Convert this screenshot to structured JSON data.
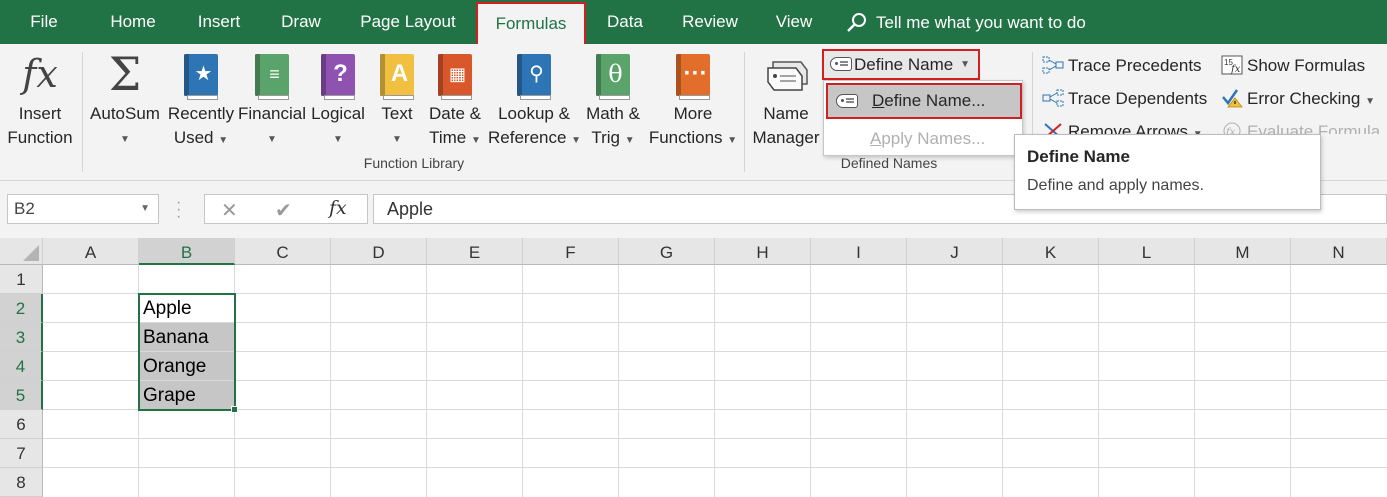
{
  "tabs": [
    "File",
    "Home",
    "Insert",
    "Draw",
    "Page Layout",
    "Formulas",
    "Data",
    "Review",
    "View"
  ],
  "active_tab": "Formulas",
  "tell_me": "Tell me what you want to do",
  "ribbon": {
    "insert_function": {
      "line1": "Insert",
      "line2": "Function"
    },
    "function_library": {
      "autosum": {
        "line1": "AutoSum"
      },
      "recently_used": {
        "line1": "Recently",
        "line2": "Used"
      },
      "financial": {
        "line1": "Financial"
      },
      "logical": {
        "line1": "Logical"
      },
      "text": {
        "line1": "Text"
      },
      "date_time": {
        "line1": "Date &",
        "line2": "Time"
      },
      "lookup_reference": {
        "line1": "Lookup &",
        "line2": "Reference"
      },
      "math_trig": {
        "line1": "Math &",
        "line2": "Trig"
      },
      "more_functions": {
        "line1": "More",
        "line2": "Functions"
      },
      "group_label": "Function Library"
    },
    "defined_names": {
      "name_manager": {
        "line1": "Name",
        "line2": "Manager"
      },
      "define_name": "Define Name",
      "group_label": "Defined Names"
    },
    "formula_auditing": {
      "trace_precedents": "Trace Precedents",
      "trace_dependents": "Trace Dependents",
      "remove_arrows": "Remove Arrows",
      "show_formulas": "Show Formulas",
      "error_checking": "Error Checking",
      "evaluate_formula": "Evaluate Formula"
    }
  },
  "dropdown": {
    "define_name_item": {
      "first_letter": "D",
      "rest": "efine Name..."
    },
    "apply_names_item": {
      "first_letter": "A",
      "rest": "pply Names..."
    }
  },
  "tooltip": {
    "title": "Define Name",
    "description": "Define and apply names."
  },
  "formula_bar": {
    "name_box": "B2",
    "content": "Apple"
  },
  "columns": [
    "A",
    "B",
    "C",
    "D",
    "E",
    "F",
    "G",
    "H",
    "I",
    "J",
    "K",
    "L",
    "M",
    "N"
  ],
  "rows": [
    "1",
    "2",
    "3",
    "4",
    "5",
    "6",
    "7",
    "8"
  ],
  "cells": {
    "B2": "Apple",
    "B3": "Banana",
    "B4": "Orange",
    "B5": "Grape"
  },
  "colors": {
    "excel_green": "#217346",
    "highlight_red": "#d22020"
  }
}
